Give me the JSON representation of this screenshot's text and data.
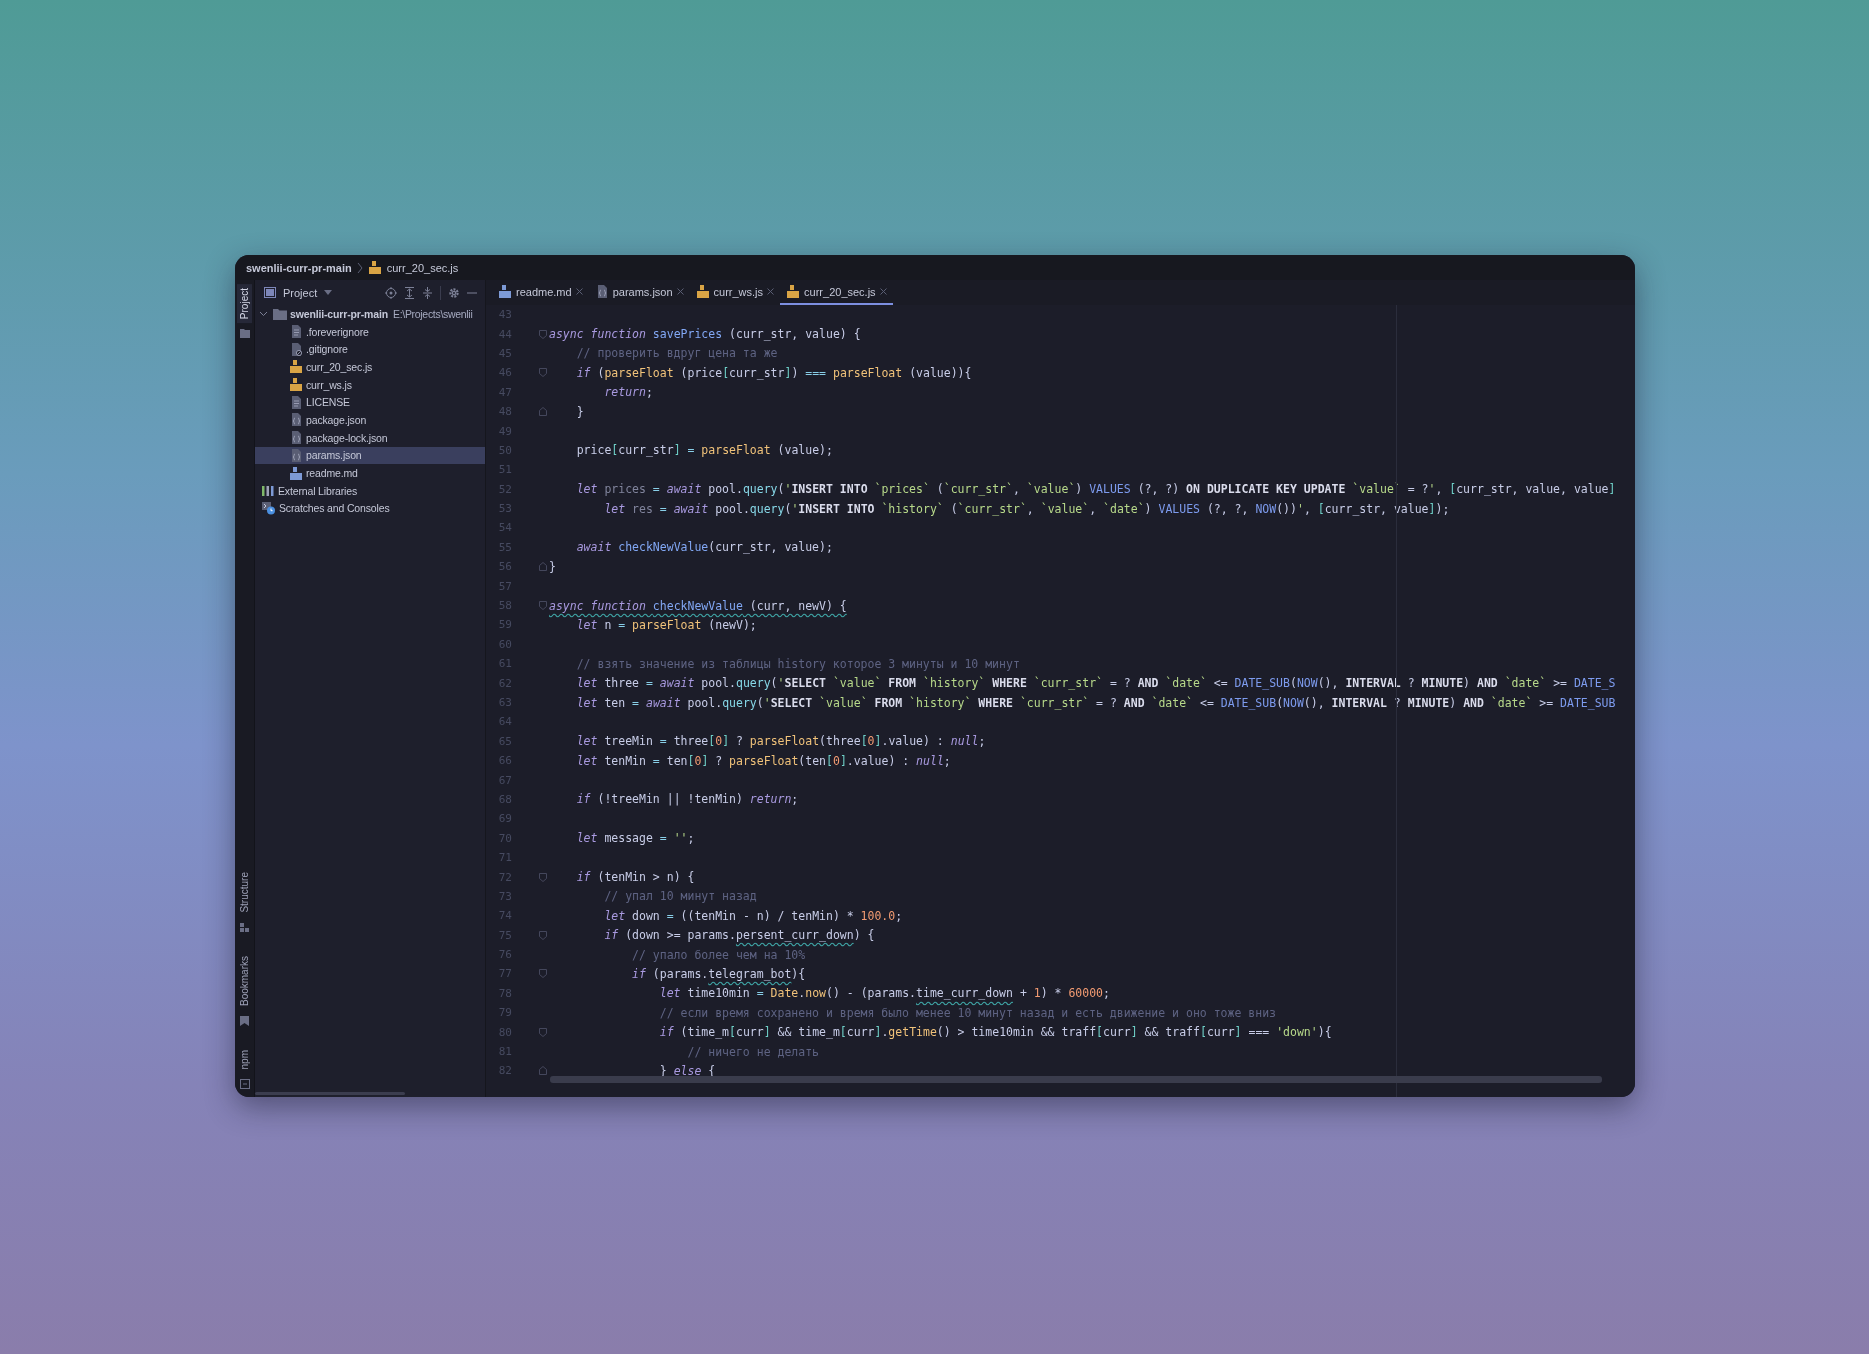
{
  "breadcrumb": {
    "project": "swenlii-curr-pr-main",
    "file": "curr_20_sec.js"
  },
  "tool_strip": {
    "top": [
      {
        "label": "Project",
        "selected": true
      }
    ],
    "bottom": [
      {
        "label": "Structure",
        "selected": false
      },
      {
        "label": "Bookmarks",
        "selected": false
      },
      {
        "label": "npm",
        "selected": false
      }
    ]
  },
  "project_panel": {
    "title": "Project",
    "tree": [
      {
        "label": "swenlii-curr-pr-main",
        "path": "E:\\Projects\\swenlii",
        "kind": "folder",
        "expanded": true,
        "selected": false,
        "children": [
          {
            "label": ".foreverignore",
            "kind": "text",
            "selected": false
          },
          {
            "label": ".gitignore",
            "kind": "ignore",
            "selected": false
          },
          {
            "label": "curr_20_sec.js",
            "kind": "js",
            "selected": false
          },
          {
            "label": "curr_ws.js",
            "kind": "js",
            "selected": false
          },
          {
            "label": "LICENSE",
            "kind": "text",
            "selected": false
          },
          {
            "label": "package.json",
            "kind": "json",
            "selected": false
          },
          {
            "label": "package-lock.json",
            "kind": "json",
            "selected": false
          },
          {
            "label": "params.json",
            "kind": "json",
            "selected": true
          },
          {
            "label": "readme.md",
            "kind": "md",
            "selected": false
          }
        ]
      },
      {
        "label": "External Libraries",
        "kind": "libraries",
        "selected": false
      },
      {
        "label": "Scratches and Consoles",
        "kind": "scratches",
        "selected": false
      }
    ]
  },
  "tabs": [
    {
      "label": "readme.md",
      "kind": "md",
      "selected": false
    },
    {
      "label": "params.json",
      "kind": "json",
      "selected": false
    },
    {
      "label": "curr_ws.js",
      "kind": "js",
      "selected": false
    },
    {
      "label": "curr_20_sec.js",
      "kind": "js",
      "selected": true
    }
  ],
  "editor": {
    "lines": [
      {
        "number": "43"
      },
      {
        "number": "44",
        "kind": "fold-start",
        "tokens": [
          {
            "kind": "kw",
            "text": "async "
          },
          {
            "kind": "kw",
            "text": "function "
          },
          {
            "kind": "decl",
            "text": "savePrices"
          },
          {
            "text": " (curr_str, value) {"
          }
        ]
      },
      {
        "number": "45",
        "tokens": [
          {
            "kind": "cm",
            "text": "    // проверить вдруг цена та же"
          }
        ]
      },
      {
        "number": "46",
        "kind": "fold-start",
        "tokens": [
          {
            "kind": "kw",
            "text": "    if"
          },
          {
            "text": " ("
          },
          {
            "kind": "fn",
            "text": "parseFloat"
          },
          {
            "text": " (price"
          },
          {
            "kind": "br",
            "text": "["
          },
          {
            "text": "curr_str"
          },
          {
            "kind": "br",
            "text": "]"
          },
          {
            "text": ") "
          },
          {
            "kind": "op",
            "text": "=== "
          },
          {
            "kind": "fn",
            "text": "parseFloat"
          },
          {
            "text": " (value)){"
          }
        ]
      },
      {
        "number": "47",
        "tokens": [
          {
            "kind": "kw",
            "text": "        return"
          },
          {
            "text": ";"
          }
        ]
      },
      {
        "number": "48",
        "kind": "fold-end",
        "tokens": [
          {
            "text": "    }"
          }
        ]
      },
      {
        "number": "49"
      },
      {
        "number": "50",
        "tokens": [
          {
            "text": "    price"
          },
          {
            "kind": "br",
            "text": "["
          },
          {
            "text": "curr_str"
          },
          {
            "kind": "br",
            "text": "]"
          },
          {
            "kind": "op",
            "text": " = "
          },
          {
            "kind": "fn",
            "text": "parseFloat"
          },
          {
            "text": " (value);"
          }
        ]
      },
      {
        "number": "51"
      },
      {
        "number": "52",
        "tokens": [
          {
            "kind": "kw",
            "text": "    let "
          },
          {
            "kind": "unused",
            "text": "prices"
          },
          {
            "kind": "op",
            "text": " = "
          },
          {
            "kind": "kw",
            "text": "await"
          },
          {
            "text": " pool."
          },
          {
            "kind": "prop",
            "text": "query"
          },
          {
            "text": "("
          },
          {
            "kind": "str",
            "text": "'"
          },
          {
            "kind": "sqlkw",
            "text": "INSERT INTO"
          },
          {
            "kind": "str",
            "text": " `prices`"
          },
          {
            "text": " ("
          },
          {
            "kind": "str",
            "text": "`curr_str`"
          },
          {
            "text": ", "
          },
          {
            "kind": "str",
            "text": "`value`"
          },
          {
            "text": ") "
          },
          {
            "kind": "sqlfn",
            "text": "VALUES"
          },
          {
            "text": " (?, ?) "
          },
          {
            "kind": "sqlkw",
            "text": "ON DUPLICATE KEY UPDATE"
          },
          {
            "kind": "str",
            "text": " `value`"
          },
          {
            "text": " = ?"
          },
          {
            "kind": "str",
            "text": "'"
          },
          {
            "text": ", "
          },
          {
            "kind": "br",
            "text": "["
          },
          {
            "text": "curr_str, value, value"
          },
          {
            "kind": "br",
            "text": "]"
          }
        ]
      },
      {
        "number": "53",
        "tokens": [
          {
            "kind": "kw",
            "text": "        let "
          },
          {
            "kind": "unused",
            "text": "res"
          },
          {
            "kind": "op",
            "text": " = "
          },
          {
            "kind": "kw",
            "text": "await"
          },
          {
            "text": " pool."
          },
          {
            "kind": "prop",
            "text": "query"
          },
          {
            "text": "("
          },
          {
            "kind": "str",
            "text": "'"
          },
          {
            "kind": "sqlkw",
            "text": "INSERT INTO"
          },
          {
            "kind": "str",
            "text": " `history`"
          },
          {
            "text": " ("
          },
          {
            "kind": "str",
            "text": "`curr_str`"
          },
          {
            "text": ", "
          },
          {
            "kind": "str",
            "text": "`value`"
          },
          {
            "text": ", "
          },
          {
            "kind": "str",
            "text": "`date`"
          },
          {
            "text": ") "
          },
          {
            "kind": "sqlfn",
            "text": "VALUES"
          },
          {
            "text": " (?, ?, "
          },
          {
            "kind": "sqlfn",
            "text": "NOW"
          },
          {
            "text": "())"
          },
          {
            "kind": "str",
            "text": "'"
          },
          {
            "text": ", "
          },
          {
            "kind": "br",
            "text": "["
          },
          {
            "text": "curr_str, value"
          },
          {
            "kind": "br",
            "text": "]"
          },
          {
            "text": ");"
          }
        ]
      },
      {
        "number": "54"
      },
      {
        "number": "55",
        "tokens": [
          {
            "kind": "kw",
            "text": "    await "
          },
          {
            "kind": "decl",
            "text": "checkNewValue"
          },
          {
            "text": "(curr_str, value);"
          }
        ]
      },
      {
        "number": "56",
        "kind": "fold-end",
        "tokens": [
          {
            "text": "}"
          }
        ]
      },
      {
        "number": "57"
      },
      {
        "number": "58",
        "kind": "fold-start",
        "warning": true,
        "tokens": [
          {
            "kind": "kw",
            "text": "async "
          },
          {
            "kind": "kw",
            "text": "function "
          },
          {
            "kind": "decl",
            "text": "checkNewValue"
          },
          {
            "text": " (curr, newV) {"
          }
        ]
      },
      {
        "number": "59",
        "tokens": [
          {
            "kind": "kw",
            "text": "    let"
          },
          {
            "text": " n "
          },
          {
            "kind": "op",
            "text": "= "
          },
          {
            "kind": "fn",
            "text": "parseFloat"
          },
          {
            "text": " (newV);"
          }
        ]
      },
      {
        "number": "60"
      },
      {
        "number": "61",
        "tokens": [
          {
            "kind": "cm",
            "text": "    // взять значение из таблицы history которое 3 минуты и 10 минут"
          }
        ]
      },
      {
        "number": "62",
        "tokens": [
          {
            "kind": "kw",
            "text": "    let"
          },
          {
            "text": " three "
          },
          {
            "kind": "op",
            "text": "= "
          },
          {
            "kind": "kw",
            "text": "await"
          },
          {
            "text": " pool."
          },
          {
            "kind": "prop",
            "text": "query"
          },
          {
            "text": "("
          },
          {
            "kind": "str",
            "text": "'"
          },
          {
            "kind": "sqlkw",
            "text": "SELECT"
          },
          {
            "kind": "str",
            "text": " `value` "
          },
          {
            "kind": "sqlkw",
            "text": "FROM"
          },
          {
            "kind": "str",
            "text": " `history` "
          },
          {
            "kind": "sqlkw",
            "text": "WHERE"
          },
          {
            "kind": "str",
            "text": " `curr_str`"
          },
          {
            "text": " = ? "
          },
          {
            "kind": "sqlkw",
            "text": "AND"
          },
          {
            "kind": "str",
            "text": " `date`"
          },
          {
            "text": " <= "
          },
          {
            "kind": "sqlfn",
            "text": "DATE_SUB"
          },
          {
            "text": "("
          },
          {
            "kind": "sqlfn",
            "text": "NOW"
          },
          {
            "text": "(), "
          },
          {
            "kind": "sqlkw",
            "text": "INTERVAL"
          },
          {
            "text": " ? "
          },
          {
            "kind": "sqlkw",
            "text": "MINUTE"
          },
          {
            "text": ") "
          },
          {
            "kind": "sqlkw",
            "text": "AND"
          },
          {
            "kind": "str",
            "text": " `date`"
          },
          {
            "text": " >= "
          },
          {
            "kind": "sqlfn",
            "text": "DATE_S"
          }
        ]
      },
      {
        "number": "63",
        "tokens": [
          {
            "kind": "kw",
            "text": "    let"
          },
          {
            "text": " ten "
          },
          {
            "kind": "op",
            "text": "= "
          },
          {
            "kind": "kw",
            "text": "await"
          },
          {
            "text": " pool."
          },
          {
            "kind": "prop",
            "text": "query"
          },
          {
            "text": "("
          },
          {
            "kind": "str",
            "text": "'"
          },
          {
            "kind": "sqlkw",
            "text": "SELECT"
          },
          {
            "kind": "str",
            "text": " `value` "
          },
          {
            "kind": "sqlkw",
            "text": "FROM"
          },
          {
            "kind": "str",
            "text": " `history` "
          },
          {
            "kind": "sqlkw",
            "text": "WHERE"
          },
          {
            "kind": "str",
            "text": " `curr_str`"
          },
          {
            "text": " = ? "
          },
          {
            "kind": "sqlkw",
            "text": "AND"
          },
          {
            "kind": "str",
            "text": " `date`"
          },
          {
            "text": " <= "
          },
          {
            "kind": "sqlfn",
            "text": "DATE_SUB"
          },
          {
            "text": "("
          },
          {
            "kind": "sqlfn",
            "text": "NOW"
          },
          {
            "text": "(), "
          },
          {
            "kind": "sqlkw",
            "text": "INTERVAL"
          },
          {
            "text": " ? "
          },
          {
            "kind": "sqlkw",
            "text": "MINUTE"
          },
          {
            "text": ") "
          },
          {
            "kind": "sqlkw",
            "text": "AND"
          },
          {
            "kind": "str",
            "text": " `date`"
          },
          {
            "text": " >= "
          },
          {
            "kind": "sqlfn",
            "text": "DATE_SUB"
          }
        ]
      },
      {
        "number": "64"
      },
      {
        "number": "65",
        "tokens": [
          {
            "kind": "kw",
            "text": "    let"
          },
          {
            "text": " treeMin "
          },
          {
            "kind": "op",
            "text": "="
          },
          {
            "text": " three"
          },
          {
            "kind": "br",
            "text": "["
          },
          {
            "kind": "num",
            "text": "0"
          },
          {
            "kind": "br",
            "text": "]"
          },
          {
            "text": " ? "
          },
          {
            "kind": "fn",
            "text": "parseFloat"
          },
          {
            "text": "(three"
          },
          {
            "kind": "br",
            "text": "["
          },
          {
            "kind": "num",
            "text": "0"
          },
          {
            "kind": "br",
            "text": "]"
          },
          {
            "text": ".value) : "
          },
          {
            "kind": "kw",
            "text": "null"
          },
          {
            "text": ";"
          }
        ]
      },
      {
        "number": "66",
        "tokens": [
          {
            "kind": "kw",
            "text": "    let"
          },
          {
            "text": " tenMin "
          },
          {
            "kind": "op",
            "text": "="
          },
          {
            "text": " ten"
          },
          {
            "kind": "br",
            "text": "["
          },
          {
            "kind": "num",
            "text": "0"
          },
          {
            "kind": "br",
            "text": "]"
          },
          {
            "text": " ? "
          },
          {
            "kind": "fn",
            "text": "parseFloat"
          },
          {
            "text": "(ten"
          },
          {
            "kind": "br",
            "text": "["
          },
          {
            "kind": "num",
            "text": "0"
          },
          {
            "kind": "br",
            "text": "]"
          },
          {
            "text": ".value) : "
          },
          {
            "kind": "kw",
            "text": "null"
          },
          {
            "text": ";"
          }
        ]
      },
      {
        "number": "67"
      },
      {
        "number": "68",
        "tokens": [
          {
            "kind": "kw",
            "text": "    if"
          },
          {
            "text": " (!treeMin || !tenMin) "
          },
          {
            "kind": "kw",
            "text": "return"
          },
          {
            "text": ";"
          }
        ]
      },
      {
        "number": "69"
      },
      {
        "number": "70",
        "tokens": [
          {
            "kind": "kw",
            "text": "    let"
          },
          {
            "text": " message "
          },
          {
            "kind": "op",
            "text": "= "
          },
          {
            "kind": "str",
            "text": "''"
          },
          {
            "text": ";"
          }
        ]
      },
      {
        "number": "71"
      },
      {
        "number": "72",
        "kind": "fold-start",
        "tokens": [
          {
            "kind": "kw",
            "text": "    if"
          },
          {
            "text": " (tenMin > n) {"
          }
        ]
      },
      {
        "number": "73",
        "tokens": [
          {
            "kind": "cm",
            "text": "        // упал 10 минут назад"
          }
        ]
      },
      {
        "number": "74",
        "tokens": [
          {
            "kind": "kw",
            "text": "        let"
          },
          {
            "text": " down "
          },
          {
            "kind": "op",
            "text": "="
          },
          {
            "text": " ((tenMin - n) / tenMin) * "
          },
          {
            "kind": "num",
            "text": "100.0"
          },
          {
            "text": ";"
          }
        ]
      },
      {
        "number": "75",
        "kind": "fold-start",
        "tokens": [
          {
            "kind": "kw",
            "text": "        if"
          },
          {
            "text": " (down >= params."
          },
          {
            "kind": "typo",
            "text": "persent_curr_down"
          },
          {
            "text": ") {"
          }
        ]
      },
      {
        "number": "76",
        "tokens": [
          {
            "kind": "cm",
            "text": "            // упало более чем на 10%"
          }
        ]
      },
      {
        "number": "77",
        "kind": "fold-start",
        "tokens": [
          {
            "kind": "kw",
            "text": "            if"
          },
          {
            "text": " (params."
          },
          {
            "kind": "typo",
            "text": "telegram_bot"
          },
          {
            "text": "){"
          }
        ]
      },
      {
        "number": "78",
        "tokens": [
          {
            "kind": "kw",
            "text": "                let"
          },
          {
            "text": " time10min "
          },
          {
            "kind": "op",
            "text": "= "
          },
          {
            "kind": "fn",
            "text": "Date"
          },
          {
            "text": "."
          },
          {
            "kind": "fn",
            "text": "now"
          },
          {
            "text": "() - (params."
          },
          {
            "kind": "typo",
            "text": "time_curr_down"
          },
          {
            "text": " + "
          },
          {
            "kind": "num",
            "text": "1"
          },
          {
            "text": ") * "
          },
          {
            "kind": "num",
            "text": "60000"
          },
          {
            "text": ";"
          }
        ]
      },
      {
        "number": "79",
        "tokens": [
          {
            "kind": "cm",
            "text": "                // если время сохранено и время было менее 10 минут назад и есть движение и оно тоже вниз"
          }
        ]
      },
      {
        "number": "80",
        "kind": "fold-start",
        "tokens": [
          {
            "kind": "kw",
            "text": "                if"
          },
          {
            "text": " (time_m"
          },
          {
            "kind": "br",
            "text": "["
          },
          {
            "text": "curr"
          },
          {
            "kind": "br",
            "text": "]"
          },
          {
            "text": " && time_m"
          },
          {
            "kind": "br",
            "text": "["
          },
          {
            "text": "curr"
          },
          {
            "kind": "br",
            "text": "]"
          },
          {
            "text": "."
          },
          {
            "kind": "fn",
            "text": "getTime"
          },
          {
            "text": "() > time10min && traff"
          },
          {
            "kind": "br",
            "text": "["
          },
          {
            "text": "curr"
          },
          {
            "kind": "br",
            "text": "]"
          },
          {
            "text": " && traff"
          },
          {
            "kind": "br",
            "text": "["
          },
          {
            "text": "curr"
          },
          {
            "kind": "br",
            "text": "]"
          },
          {
            "text": " === "
          },
          {
            "kind": "str",
            "text": "'down'"
          },
          {
            "text": "){"
          }
        ]
      },
      {
        "number": "81",
        "tokens": [
          {
            "kind": "cm",
            "text": "                    // ничего не делать"
          }
        ]
      },
      {
        "number": "82",
        "kind": "fold-end",
        "tokens": [
          {
            "text": "                } "
          },
          {
            "kind": "kw",
            "text": "else"
          },
          {
            "text": " {"
          }
        ]
      }
    ]
  }
}
